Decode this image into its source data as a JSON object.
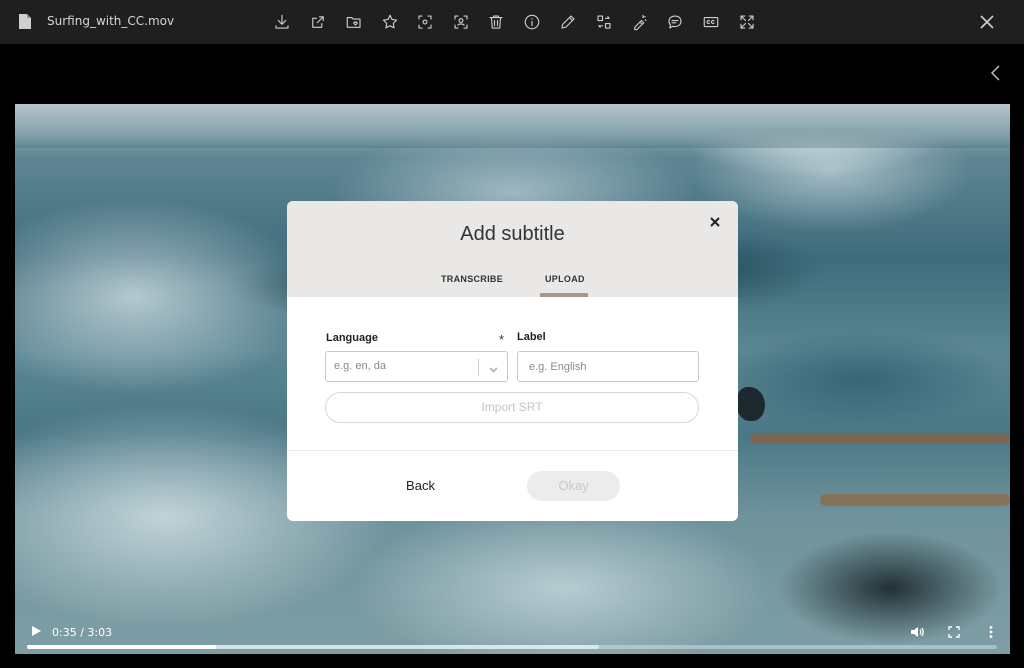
{
  "titlebar": {
    "file_name": "Surfing_with_CC.mov",
    "toolbar_icons": [
      "download-icon",
      "share-icon",
      "folder-heart-icon",
      "star-icon",
      "focus-icon",
      "person-frame-icon",
      "trash-icon",
      "info-icon",
      "edit-icon",
      "swap-icon",
      "magic-edit-icon",
      "comment-icon",
      "closed-caption-icon",
      "expand-icon"
    ]
  },
  "player": {
    "time_display": "0:35 / 3:03",
    "progress_fraction": 0.195,
    "buffered_fraction": 0.59
  },
  "modal": {
    "title": "Add subtitle",
    "tabs": [
      {
        "label": "TRANSCRIBE",
        "active": false
      },
      {
        "label": "UPLOAD",
        "active": true
      }
    ],
    "language_label": "Language",
    "language_placeholder": "e.g. en, da",
    "required_mark": "*",
    "label_label": "Label",
    "label_placeholder": "e.g. English",
    "import_button": "Import SRT",
    "back_button": "Back",
    "okay_button": "Okay"
  },
  "colors": {
    "toolbar_bg": "#1f1f1f",
    "modal_header_bg": "#e9e8e6",
    "tab_underline": "#a59a89"
  }
}
